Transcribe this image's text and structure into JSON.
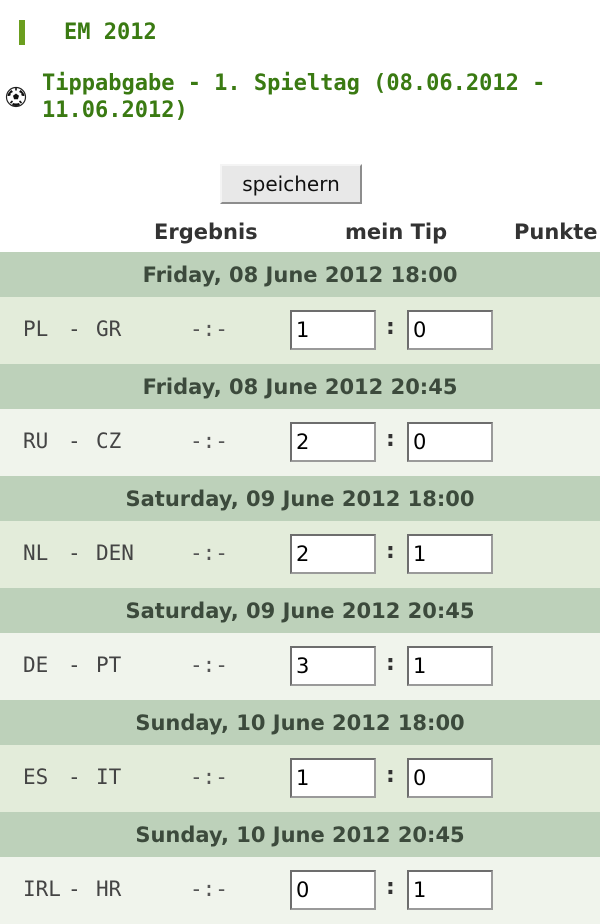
{
  "section": {
    "title": "EM 2012"
  },
  "page": {
    "title": "Tippabgabe - 1. Spieltag (08.06.2012 - 11.06.2012)"
  },
  "actions": {
    "save_label": "speichern"
  },
  "columns": {
    "result": "Ergebnis",
    "tip": "mein Tip",
    "points": "Punkte"
  },
  "matches": [
    {
      "date": "Friday, 08 June 2012 18:00",
      "home": "PL",
      "away": "GR",
      "result": "-:-",
      "tip_home": "1",
      "tip_away": "0"
    },
    {
      "date": "Friday, 08 June 2012 20:45",
      "home": "RU",
      "away": "CZ",
      "result": "-:-",
      "tip_home": "2",
      "tip_away": "0"
    },
    {
      "date": "Saturday, 09 June 2012 18:00",
      "home": "NL",
      "away": "DEN",
      "result": "-:-",
      "tip_home": "2",
      "tip_away": "1"
    },
    {
      "date": "Saturday, 09 June 2012 20:45",
      "home": "DE",
      "away": "PT",
      "result": "-:-",
      "tip_home": "3",
      "tip_away": "1"
    },
    {
      "date": "Sunday, 10 June 2012 18:00",
      "home": "ES",
      "away": "IT",
      "result": "-:-",
      "tip_home": "1",
      "tip_away": "0"
    },
    {
      "date": "Sunday, 10 June 2012 20:45",
      "home": "IRL",
      "away": "HR",
      "result": "-:-",
      "tip_home": "0",
      "tip_away": "1"
    }
  ],
  "team_separator": "-",
  "tip_separator": ":",
  "colors": {
    "accent_green": "#3a7a12",
    "date_row_bg": "#bdd1ba",
    "match_row_bg": "#e3ecda"
  },
  "icons": {
    "section_marker": "green-bar",
    "title_icon": "soccer-ball-icon"
  }
}
